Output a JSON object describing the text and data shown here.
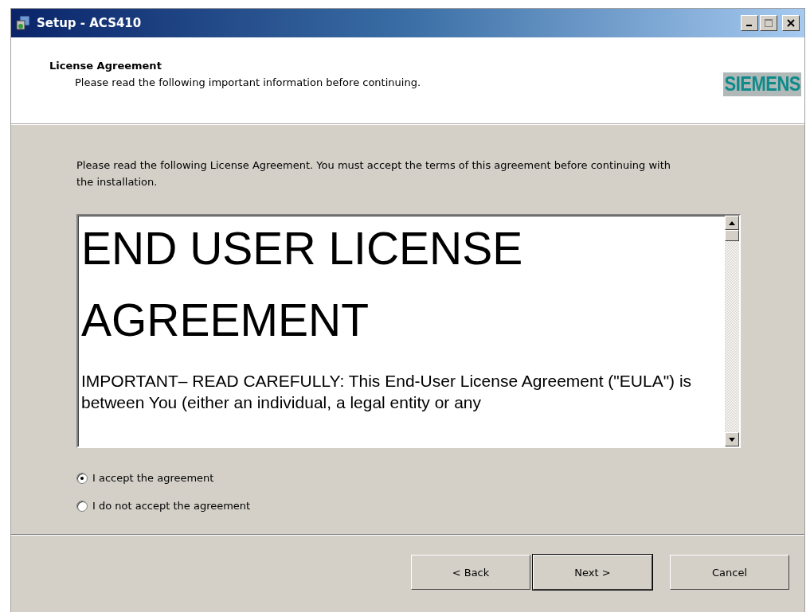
{
  "window": {
    "title": "Setup - ACS410"
  },
  "header": {
    "title": "License Agreement",
    "subtitle": "Please read the following important information before continuing.",
    "logo": "SIEMENS"
  },
  "instructions": "Please read the following License Agreement. You must accept the terms of this agreement before continuing with the installation.",
  "license": {
    "heading": "END USER LICENSE AGREEMENT",
    "body": "IMPORTANT– READ CAREFULLY: This End-User License Agreement (\"EULA\") is between You (either an individual, a legal entity or any"
  },
  "options": [
    {
      "label": "I accept the agreement",
      "selected": true
    },
    {
      "label": "I do not accept the agreement",
      "selected": false
    }
  ],
  "buttons": [
    {
      "label": "< Back",
      "default": false
    },
    {
      "label": "Next >",
      "default": true
    },
    {
      "label": "Cancel",
      "default": false
    }
  ]
}
